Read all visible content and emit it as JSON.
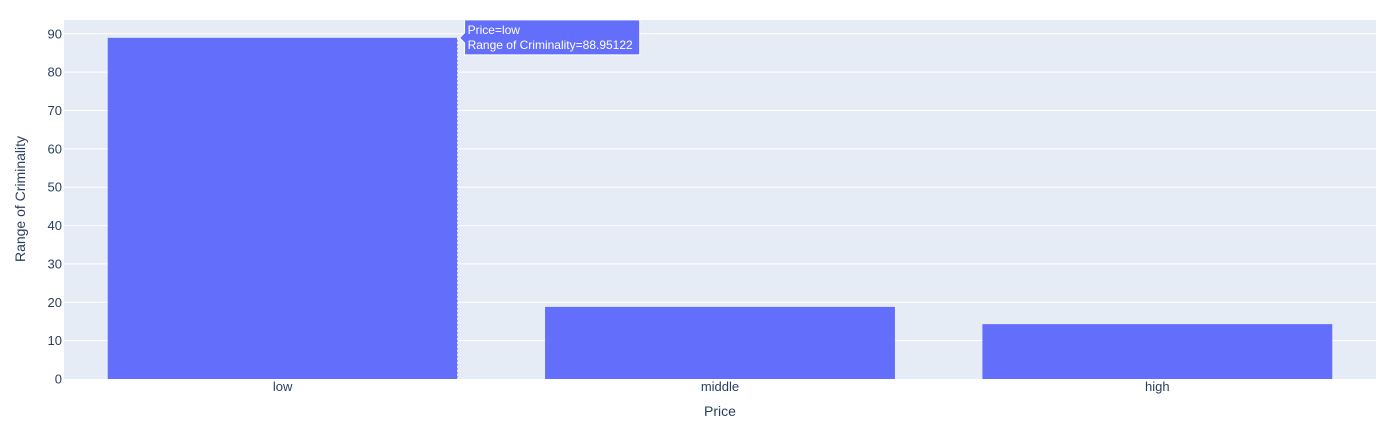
{
  "chart_data": {
    "type": "bar",
    "categories": [
      "low",
      "middle",
      "high"
    ],
    "values": [
      88.95122,
      18.8,
      14.3
    ],
    "xlabel": "Price",
    "ylabel": "Range of Criminality",
    "ylim": [
      0,
      93.6
    ],
    "yticks": [
      0,
      10,
      20,
      30,
      40,
      50,
      60,
      70,
      80,
      90
    ],
    "grid": true,
    "colors": {
      "bar": "#636efa",
      "plot_bg": "#e5ecf6",
      "grid": "#ffffff",
      "text": "#2a3f5f"
    },
    "hover": {
      "category_index": 0,
      "line1": "Price=low",
      "line2": "Range of Criminality=88.95122"
    }
  }
}
